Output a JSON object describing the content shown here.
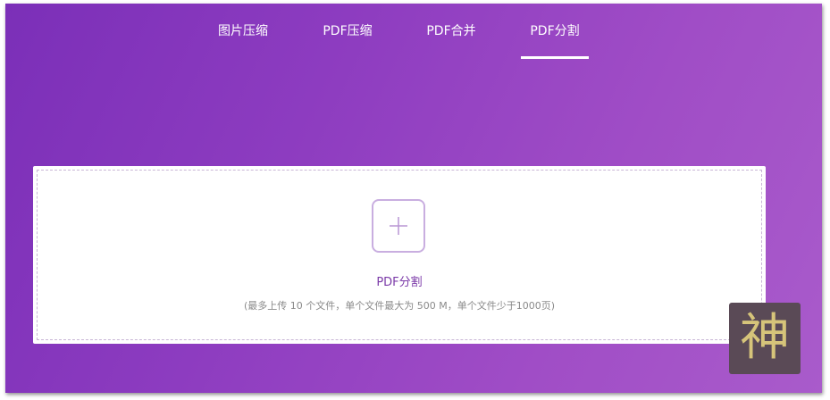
{
  "tabs": [
    {
      "label": "图片压缩",
      "active": false
    },
    {
      "label": "PDF压缩",
      "active": false
    },
    {
      "label": "PDF合并",
      "active": false
    },
    {
      "label": "PDF分割",
      "active": true
    }
  ],
  "upload": {
    "icon": "plus-icon",
    "title": "PDF分割",
    "hint": "(最多上传 10 个文件，单个文件最大为 500 M，单个文件少于1000页)"
  },
  "watermark": {
    "text": "神"
  },
  "colors": {
    "background_start": "#7b2fb8",
    "background_end": "#a95bcb",
    "accent": "#7b3aa8",
    "plus_border": "#c9aee0",
    "badge_bg": "#5a4a56",
    "badge_text": "#d6c47a"
  }
}
